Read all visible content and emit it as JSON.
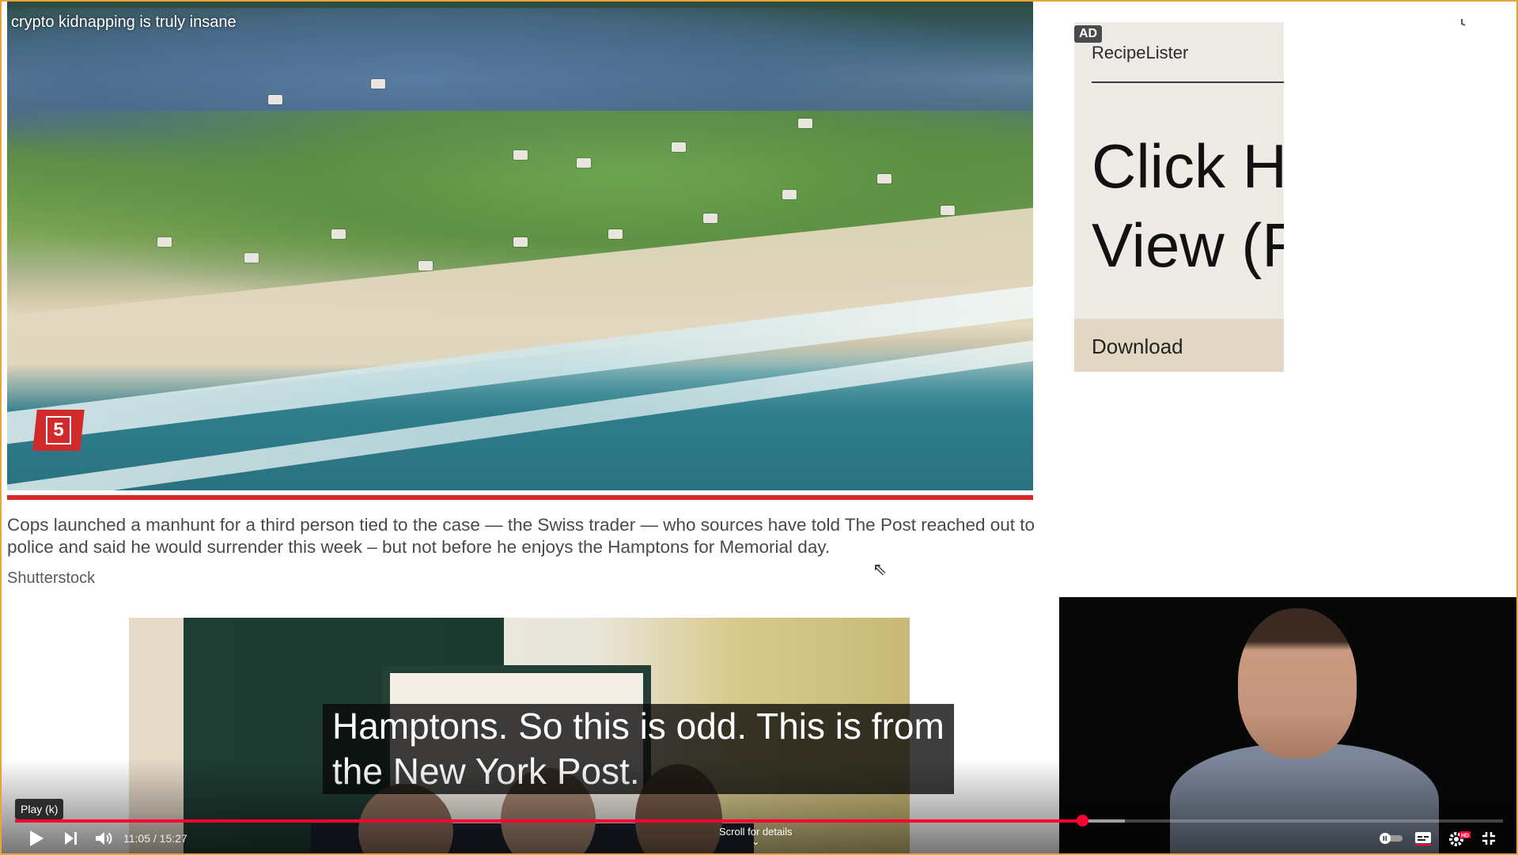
{
  "video": {
    "title": "crypto kidnapping is truly insane",
    "badge_number": "5",
    "caption": "Cops launched a manhunt for a third person tied to the case — the Swiss trader — who sources have told The Post reached out to police and said he would surrender this week – but not before he enjoys the Hamptons for Memorial day.",
    "credit": "Shutterstock",
    "subtitle_line1": "Hamptons. So this is odd. This is from",
    "subtitle_line2": "the New York Post."
  },
  "ad": {
    "badge": "AD",
    "advertiser": "RecipeLister",
    "headline_line1": "Click H",
    "headline_line2": "View (F",
    "cta": "Download"
  },
  "header_icons": {
    "watch_later": "clock-icon",
    "share": "share-icon"
  },
  "controls": {
    "tooltip": "Play (k)",
    "current_time": "11:05",
    "duration": "15:27",
    "time_display": "11:05 / 15:27",
    "scroll_hint": "Scroll for details",
    "progress_fraction": 0.717,
    "buffer_fraction": 0.746,
    "icons": [
      "play-icon",
      "next-icon",
      "volume-icon",
      "autoplay-toggle-icon",
      "subtitles-icon",
      "settings-icon",
      "exit-fullscreen-icon"
    ],
    "settings_badge": "HD"
  },
  "colors": {
    "accent_red": "#ff0033",
    "badge_red": "#d12a2a",
    "frame_orange": "#e8a33a"
  }
}
